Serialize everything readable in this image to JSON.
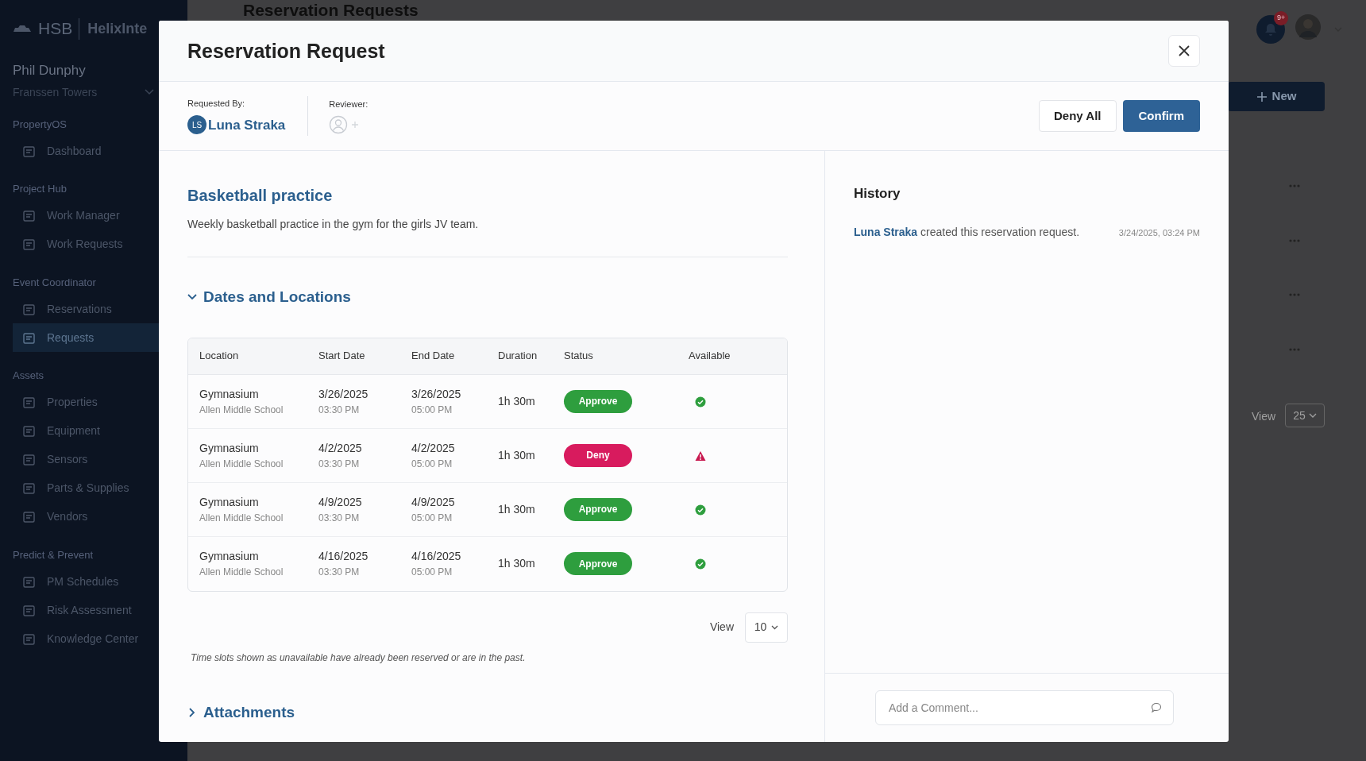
{
  "background_page": {
    "brand": "HSB",
    "product": "HelixInte",
    "user": "Phil Dunphy",
    "property": "Franssen Towers",
    "page_title": "Reservation Requests",
    "notification_count": "9+",
    "new_button": "New",
    "view_label": "View",
    "view_value": "25",
    "sidebar": [
      {
        "title": "PropertyOS",
        "items": [
          {
            "label": "Dashboard",
            "selected": false
          }
        ]
      },
      {
        "title": "Project Hub",
        "items": [
          {
            "label": "Work Manager",
            "selected": false
          },
          {
            "label": "Work Requests",
            "selected": false
          }
        ]
      },
      {
        "title": "Event Coordinator",
        "items": [
          {
            "label": "Reservations",
            "selected": false
          },
          {
            "label": "Requests",
            "selected": true
          }
        ]
      },
      {
        "title": "Assets",
        "items": [
          {
            "label": "Properties",
            "selected": false
          },
          {
            "label": "Equipment",
            "selected": false
          },
          {
            "label": "Sensors",
            "selected": false
          },
          {
            "label": "Parts & Supplies",
            "selected": false
          },
          {
            "label": "Vendors",
            "selected": false
          }
        ]
      },
      {
        "title": "Predict & Prevent",
        "items": [
          {
            "label": "PM Schedules",
            "selected": false
          },
          {
            "label": "Risk Assessment",
            "selected": false
          },
          {
            "label": "Knowledge Center",
            "selected": false
          }
        ]
      }
    ]
  },
  "modal": {
    "title": "Reservation Request",
    "requested_by_label": "Requested By:",
    "requester_initials": "LS",
    "requester_name": "Luna Straka",
    "reviewer_label": "Reviewer:",
    "buttons": [
      {
        "label": "Deny All",
        "kind": "secondary"
      },
      {
        "label": "Confirm",
        "kind": "primary"
      }
    ],
    "event_title": "Basketball practice",
    "event_description": "Weekly basketball practice in the gym for the girls JV team.",
    "sections": [
      {
        "title": "Dates and Locations",
        "expanded": true
      },
      {
        "title": "Attachments",
        "expanded": false
      }
    ],
    "table": {
      "columns": [
        "Location",
        "Start Date",
        "End Date",
        "Duration",
        "Status",
        "Available"
      ],
      "rows": [
        {
          "location": "Gymnasium",
          "place": "Allen Middle School",
          "start_date": "3/26/2025",
          "start_time": "03:30 PM",
          "end_date": "3/26/2025",
          "end_time": "05:00 PM",
          "duration": "1h 30m",
          "status": "Approve",
          "kind": "approve",
          "available": true
        },
        {
          "location": "Gymnasium",
          "place": "Allen Middle School",
          "start_date": "4/2/2025",
          "start_time": "03:30 PM",
          "end_date": "4/2/2025",
          "end_time": "05:00 PM",
          "duration": "1h 30m",
          "status": "Deny",
          "kind": "deny",
          "available": false
        },
        {
          "location": "Gymnasium",
          "place": "Allen Middle School",
          "start_date": "4/9/2025",
          "start_time": "03:30 PM",
          "end_date": "4/9/2025",
          "end_time": "05:00 PM",
          "duration": "1h 30m",
          "status": "Approve",
          "kind": "approve",
          "available": true
        },
        {
          "location": "Gymnasium",
          "place": "Allen Middle School",
          "start_date": "4/16/2025",
          "start_time": "03:30 PM",
          "end_date": "4/16/2025",
          "end_time": "05:00 PM",
          "duration": "1h 30m",
          "status": "Approve",
          "kind": "approve",
          "available": true
        }
      ]
    },
    "view_label": "View",
    "view_value": "10",
    "footnote": "Time slots shown as unavailable have already been reserved or are in the past.",
    "history_title": "History",
    "history": [
      {
        "author": "Luna Straka",
        "text": "created this reservation request.",
        "time": "3/24/2025, 03:24 PM"
      }
    ],
    "comment_placeholder": "Add a Comment..."
  }
}
